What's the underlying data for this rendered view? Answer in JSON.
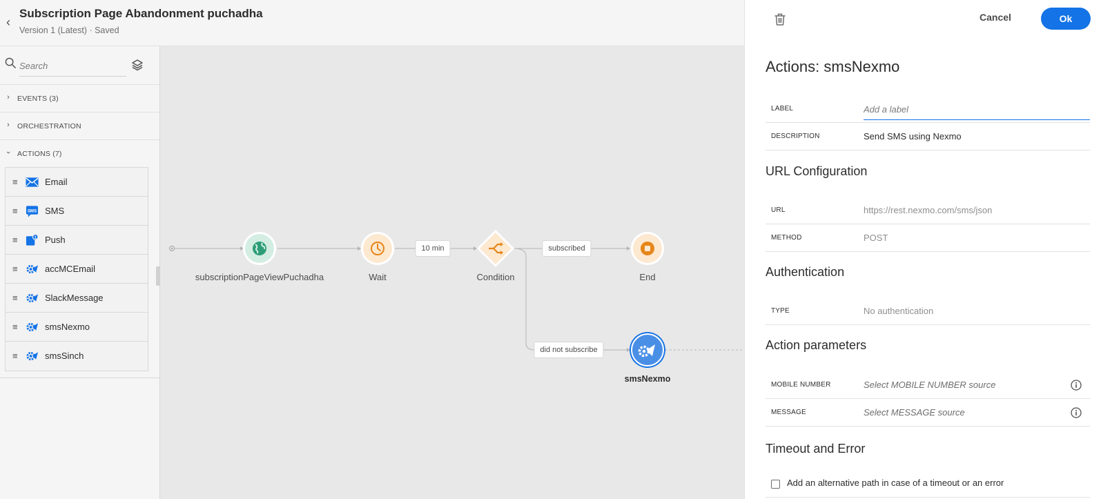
{
  "header": {
    "title": "Subscription Page Abandonment puchadha",
    "version": "Version 1 (Latest) · Saved"
  },
  "sidebar": {
    "search_placeholder": "Search",
    "sections": [
      {
        "label": "EVENTS (3)",
        "expanded": false
      },
      {
        "label": "ORCHESTRATION",
        "expanded": false
      },
      {
        "label": "ACTIONS (7)",
        "expanded": true
      }
    ],
    "actions": [
      {
        "label": "Email",
        "icon": "email-icon"
      },
      {
        "label": "SMS",
        "icon": "sms-icon"
      },
      {
        "label": "Push",
        "icon": "push-icon"
      },
      {
        "label": "accMCEmail",
        "icon": "custom-action-icon"
      },
      {
        "label": "SlackMessage",
        "icon": "custom-action-icon"
      },
      {
        "label": "smsNexmo",
        "icon": "custom-action-icon"
      },
      {
        "label": "smsSinch",
        "icon": "custom-action-icon"
      }
    ]
  },
  "canvas": {
    "nodes": [
      {
        "label": "subscriptionPageViewPuchadha",
        "type": "event",
        "icon": "globe-icon",
        "color": "#2d9d78"
      },
      {
        "label": "Wait",
        "type": "wait",
        "icon": "clock-icon",
        "color": "#e68619"
      },
      {
        "label": "Condition",
        "type": "condition",
        "icon": "split-icon",
        "color": "#e68619"
      },
      {
        "label": "End",
        "type": "end",
        "icon": "stop-icon",
        "color": "#e68619"
      },
      {
        "label": "smsNexmo",
        "type": "action",
        "icon": "custom-action-icon",
        "color": "#1473e6",
        "selected": true
      }
    ],
    "edges": [
      {
        "label": "10 min"
      },
      {
        "label": "subscribed"
      },
      {
        "label": "did not subscribe"
      }
    ]
  },
  "panel": {
    "cancel_label": "Cancel",
    "ok_label": "Ok",
    "title": "Actions: smsNexmo",
    "label_field": {
      "label": "LABEL",
      "placeholder": "Add a label"
    },
    "description_field": {
      "label": "DESCRIPTION",
      "value": "Send SMS using Nexmo"
    },
    "url_section": "URL Configuration",
    "url_field": {
      "label": "URL",
      "value": "https://rest.nexmo.com/sms/json"
    },
    "method_field": {
      "label": "METHOD",
      "value": "POST"
    },
    "auth_section": "Authentication",
    "type_field": {
      "label": "TYPE",
      "value": "No authentication"
    },
    "params_section": "Action parameters",
    "mobile_field": {
      "label": "MOBILE NUMBER",
      "placeholder": "Select MOBILE NUMBER source"
    },
    "message_field": {
      "label": "MESSAGE",
      "placeholder": "Select MESSAGE source"
    },
    "timeout_section": "Timeout and Error",
    "timeout_checkbox": {
      "label": "Add an alternative path in case of a timeout or an error",
      "checked": false
    }
  },
  "colors": {
    "accent": "#1473e6",
    "event_green": "#2d9d78",
    "orchestration_orange": "#e68619"
  }
}
